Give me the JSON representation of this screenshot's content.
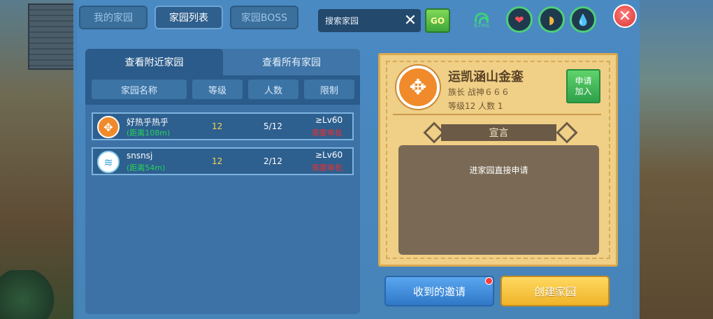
{
  "tabs": {
    "my_homeland": "我的家园",
    "homeland_list": "家园列表",
    "homeland_boss": "家园BOSS"
  },
  "search": {
    "placeholder": "搜索家园",
    "go_label": "GO",
    "icon_clear": "close-icon"
  },
  "status_bar": {
    "ping": "67ms",
    "icons": [
      "wifi-signal-icon",
      "heart-icon",
      "food-icon",
      "water-drop-icon"
    ]
  },
  "close_icon": "close-icon",
  "list": {
    "tab_nearby": "查看附近家园",
    "tab_all": "查看所有家园",
    "columns": [
      "家园名称",
      "等级",
      "人数",
      "限制"
    ],
    "rows": [
      {
        "name": "好热乎热乎",
        "distance": "(距离108m)",
        "level": "12",
        "members": "5/12",
        "requirement": "≥Lv60",
        "status": "需要审批",
        "avatar": "lobster-icon"
      },
      {
        "name": "snsnsj",
        "distance": "(距离54m)",
        "level": "12",
        "members": "2/12",
        "requirement": "≥Lv60",
        "status": "需要审批",
        "avatar": "wave-icon"
      }
    ]
  },
  "detail": {
    "name": "运凯涵山金銮",
    "leader": "族长 战神６６６",
    "stats": "等级12   人数 1",
    "apply_line1": "申请",
    "apply_line2": "加入",
    "declaration_title": "宣言",
    "declaration_text": "进家园直接申请",
    "avatar": "lobster-icon"
  },
  "buttons": {
    "received_invites": "收到的邀请",
    "create_homeland": "创建家园"
  },
  "colors": {
    "accent_green": "#3ea63a",
    "status_red": "#e8302f",
    "level_yellow": "#f5d84e",
    "card_bg": "#f0cf86"
  }
}
